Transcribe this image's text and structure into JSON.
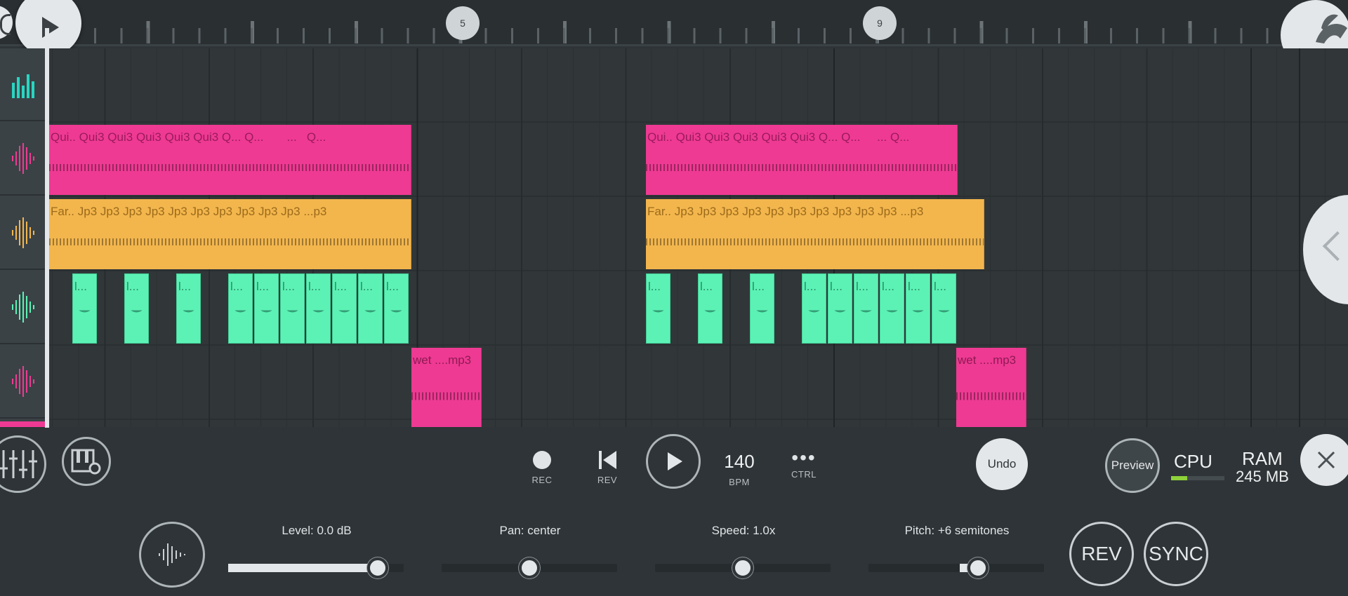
{
  "ruler": {
    "markers": [
      "5",
      "9"
    ]
  },
  "tracks": [
    {
      "icon": "equalizer-icon",
      "color": "#27d6c2"
    },
    {
      "icon": "waveform-icon",
      "color": "#ee3a93"
    },
    {
      "icon": "waveform-icon",
      "color": "#f3b64d"
    },
    {
      "icon": "waveform-icon",
      "color": "#5cf2b5"
    },
    {
      "icon": "waveform-icon",
      "color": "#ee3a93"
    }
  ],
  "clips": {
    "pink_labels_a": [
      "Qui..",
      "Qui3",
      "Qui3",
      "Qui3",
      "Qui3",
      "Qui3",
      "Q...",
      "Q...",
      "...",
      "Q..."
    ],
    "pink_labels_b": [
      "Qui..",
      "Qui3",
      "Qui3",
      "Qui3",
      "Qui3",
      "Qui3",
      "Q...",
      "Q...",
      "...",
      "Q..."
    ],
    "orange_labels": [
      "Far..",
      "Jp3",
      "Jp3",
      "Jp3",
      "Jp3",
      "Jp3",
      "Jp3",
      "Jp3",
      "Jp3",
      "Jp3",
      "Jp3",
      "...p3"
    ],
    "mint_label": "l...",
    "wet_label": "wet ....mp3"
  },
  "transport": {
    "rec": "REC",
    "rev": "REV",
    "bpm_value": "140",
    "bpm": "BPM",
    "ctrl": "CTRL",
    "undo": "Undo",
    "preview": "Preview",
    "cpu": "CPU",
    "cpu_load": 0.3,
    "ram": "RAM",
    "ram_value": "245 MB"
  },
  "controls": {
    "level": {
      "label": "Level: 0.0 dB",
      "value": 0.88
    },
    "pan": {
      "label": "Pan: center",
      "value": 0.5
    },
    "speed": {
      "label": "Speed: 1.0x",
      "value": 0.5
    },
    "pitch": {
      "label": "Pitch: +6 semitones",
      "value": 0.62
    },
    "rev_button": "REV",
    "sync_button": "SYNC"
  },
  "colors": {
    "pink": "#ee3a93",
    "orange": "#f3b64d",
    "mint": "#5cf2b5",
    "background": "#2e3437"
  }
}
